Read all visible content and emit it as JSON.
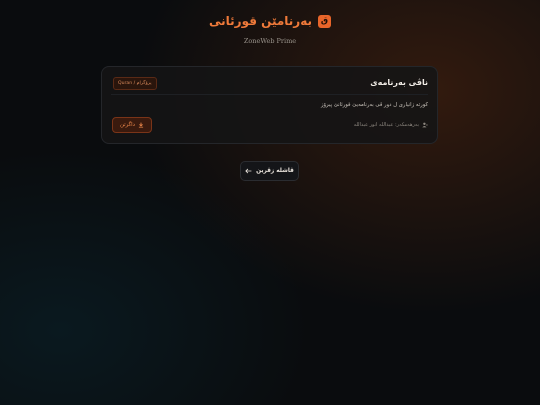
{
  "app": {
    "title": "بەرنامێن قورئانی",
    "logo_glyph": "ق",
    "subtitle": "ZoneWeb Prime",
    "accent": "#f07a3a"
  },
  "program": {
    "name": "ناڤی بەرنامەی",
    "badge": "پرۆگرام / Quran",
    "description": "کورتە زانیاری ل دور ڤی بەرنامەیێ قورئانێ پیرۆز",
    "download_label": "داگرتن",
    "author_label": "بەرهەمکەر: عبداللە انور عبداللە"
  },
  "nav": {
    "back_label": "ڤاشلە زڤرین"
  },
  "icons": {
    "logo": "book-icon",
    "download": "download-icon",
    "author": "user-icon",
    "back": "arrow-left-icon"
  }
}
